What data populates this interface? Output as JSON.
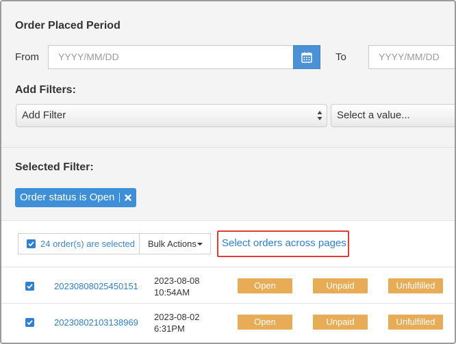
{
  "order_period": {
    "title": "Order Placed Period",
    "from_label": "From",
    "from_placeholder": "YYYY/MM/DD",
    "to_label": "To",
    "to_placeholder": "YYYY/MM/DD"
  },
  "filters": {
    "title": "Add Filters:",
    "add_filter_value": "Add Filter",
    "value_placeholder": "Select a value..."
  },
  "selected_filter": {
    "title": "Selected Filter:",
    "chip_label": "Order status is Open"
  },
  "toolbar": {
    "selected_count_label": "24 order(s) are selected",
    "bulk_actions_label": "Bulk Actions",
    "select_across_pages_label": "Select orders across pages"
  },
  "orders": [
    {
      "id": "20230808025450151",
      "date": "2023-08-08",
      "time": "10:54AM",
      "status": "Open",
      "payment": "Unpaid",
      "fulfillment": "Unfulfilled",
      "checked": true
    },
    {
      "id": "20230802103138969",
      "date": "2023-08-02",
      "time": "6:31PM",
      "status": "Open",
      "payment": "Unpaid",
      "fulfillment": "Unfulfilled",
      "checked": true
    }
  ],
  "colors": {
    "accent": "#3d8fd8",
    "link": "#2e7fd0",
    "badge": "#e8ac57",
    "highlight": "#e23c32"
  }
}
